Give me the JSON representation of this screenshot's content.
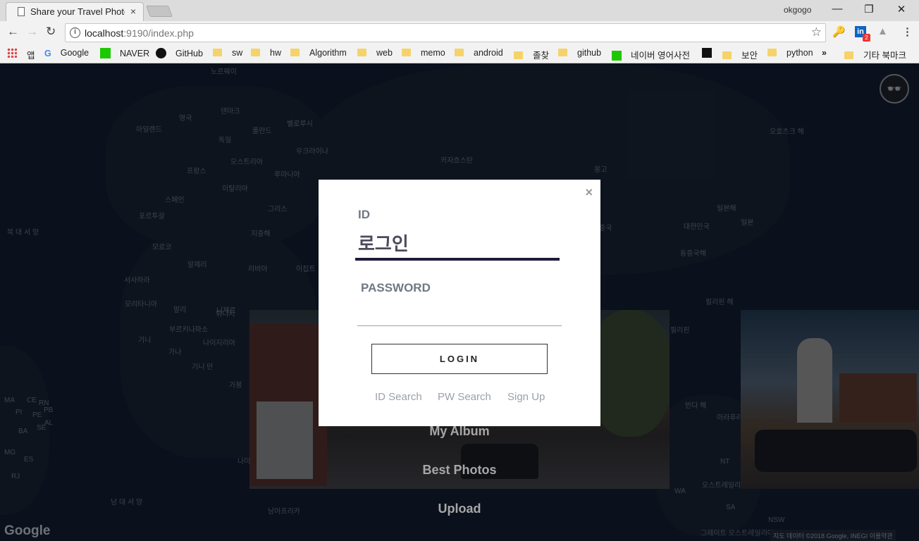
{
  "browser": {
    "tab_title": "Share your Travel Photo",
    "tab_close": "×",
    "profile_name": "okgogo",
    "url_host": "localhost",
    "url_rest": ":9190/index.php",
    "window_minimize": "—",
    "window_restore": "❐",
    "window_close": "✕",
    "ext_badge": "2"
  },
  "bookmarks": {
    "apps": "앱",
    "items": [
      "Google",
      "NAVER",
      "GitHub",
      "sw",
      "hw",
      "Algorithm",
      "web",
      "memo",
      "android",
      "졸찾",
      "github",
      "네이버 영어사전",
      "보안",
      "python"
    ],
    "more": "»",
    "other": "기타 북마크"
  },
  "map": {
    "labels": [
      "노르웨이",
      "아일랜드",
      "영국",
      "덴마크",
      "독일",
      "폴란드",
      "벨로루시",
      "오스트리아",
      "우크라이나",
      "카자흐스탄",
      "몽고",
      "오호츠크 해",
      "프랑스",
      "루마니아",
      "이탈리아",
      "스페인",
      "포르투갈",
      "그리스",
      "북 대 서 양",
      "모로코",
      "튀니지",
      "지중해",
      "일본해",
      "일본",
      "대한민국",
      "동중국해",
      "알제리",
      "리비아",
      "이집트",
      "서사하라",
      "모리타니아",
      "말리",
      "니제르",
      "부르키나파소",
      "나이지리아",
      "가나",
      "기니",
      "기니 만",
      "가봉",
      "필리핀",
      "필리핀 해",
      "반다 해",
      "아라푸라해",
      "오스트레일리아",
      "남 대 서 양",
      "남아프리카",
      "그레이트 오스트레일리아 만",
      "MA",
      "CE",
      "RN",
      "PB",
      "PI",
      "PE",
      "AL",
      "BA",
      "SE",
      "MG",
      "ES",
      "RJ",
      "NT",
      "WA",
      "SA",
      "NSW",
      "나미",
      "중국"
    ],
    "google_logo": "Google",
    "credit": "지도 데이터 ©2018 Google, INEGI   이용약관"
  },
  "menu": {
    "my_album": "My Album",
    "best_photos": "Best Photos",
    "upload": "Upload"
  },
  "login": {
    "close": "×",
    "id_label": "ID",
    "id_value": "로그인",
    "pw_label": "PASSWORD",
    "login_button": "LOGIN",
    "id_search": "ID Search",
    "pw_search": "PW Search",
    "sign_up": "Sign Up"
  }
}
